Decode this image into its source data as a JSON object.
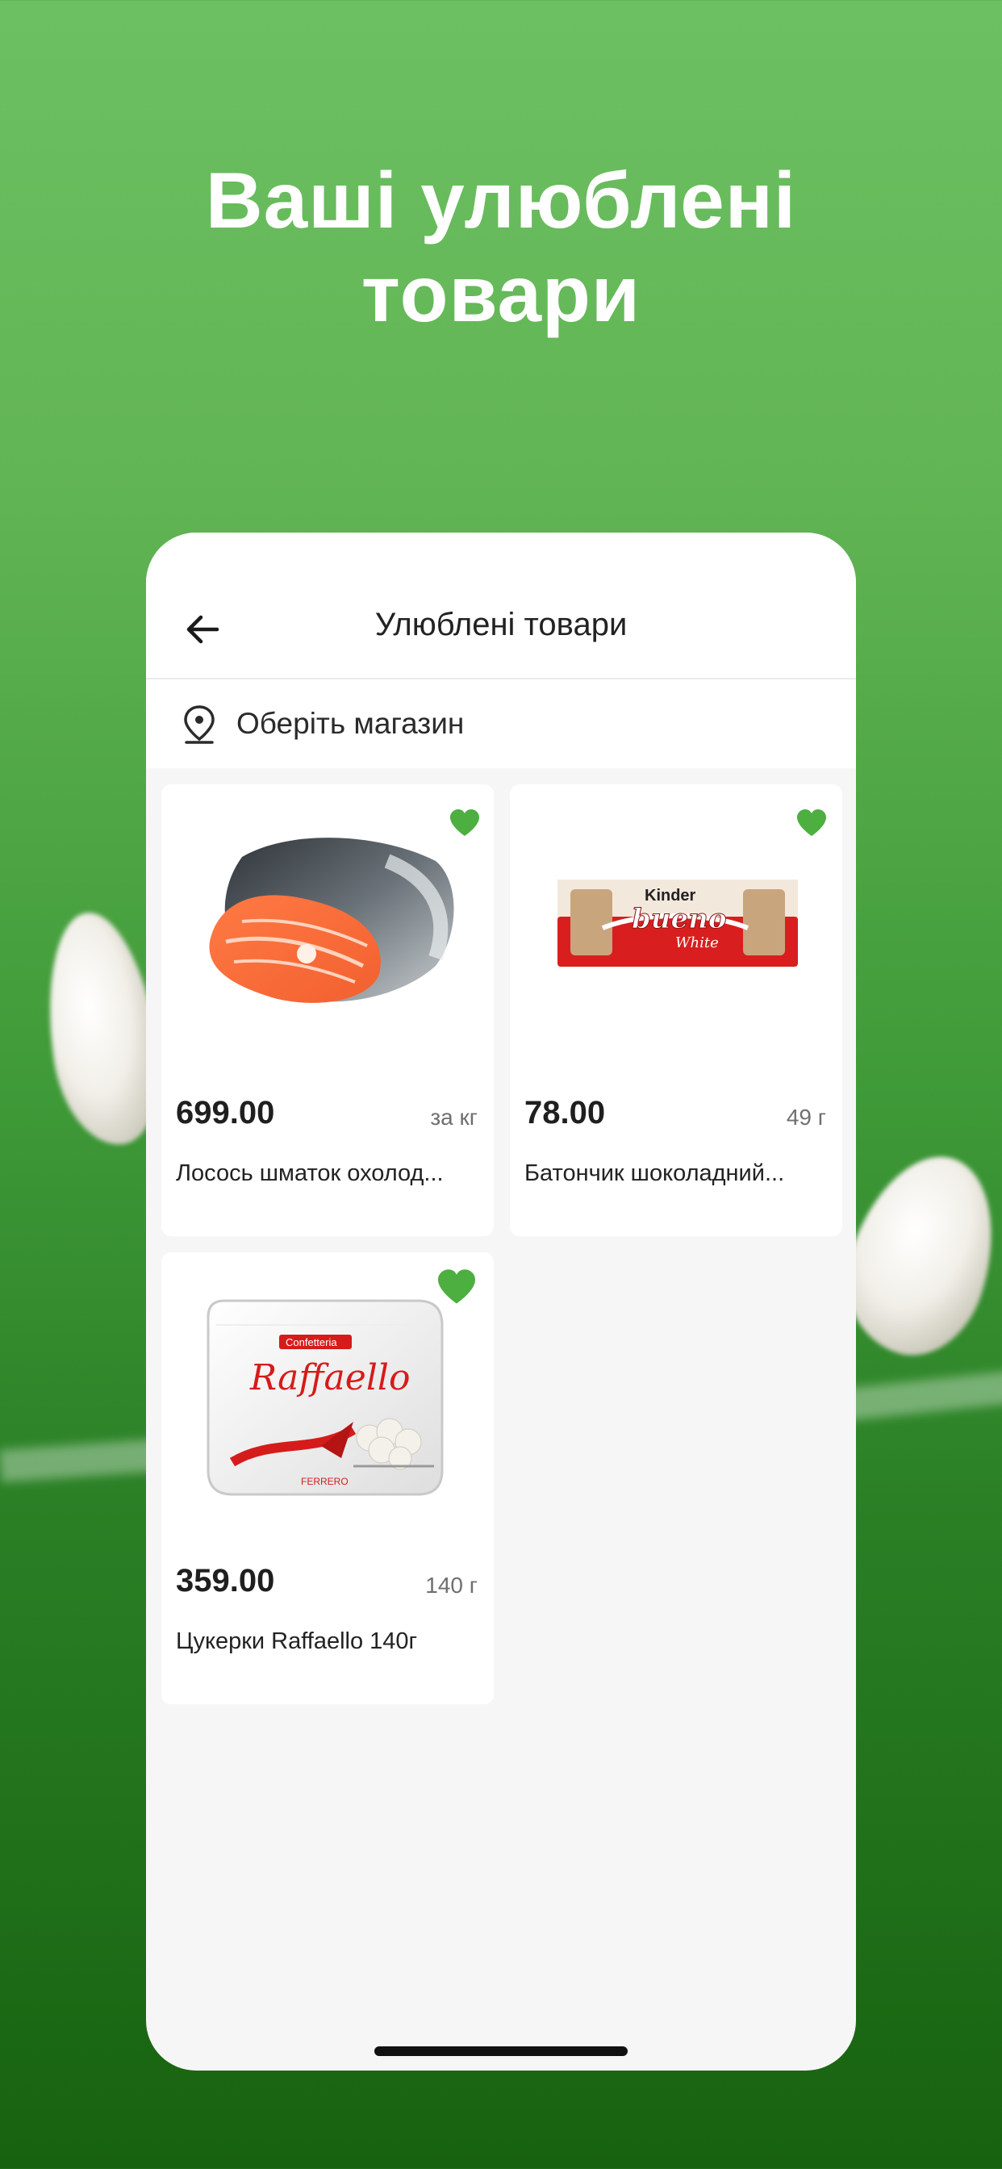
{
  "promo": {
    "title_line1": "Ваші улюблені",
    "title_line2": "товари"
  },
  "header": {
    "title": "Улюблені товари",
    "back_icon": "arrow-left-icon"
  },
  "store": {
    "label": "Оберіть магазин",
    "icon": "location-pin-icon"
  },
  "products": [
    {
      "price": "699.00",
      "unit": "за кг",
      "name": "Лосось шматок охолод...",
      "image_icon": "salmon-steak-image",
      "favorite": true
    },
    {
      "price": "78.00",
      "unit": "49 г",
      "name": "Батончик шоколадний...",
      "image_icon": "kinder-bueno-bar-image",
      "favorite": true
    },
    {
      "price": "359.00",
      "unit": "140 г",
      "name": "Цукерки Raffaello 140г",
      "image_icon": "raffaello-box-image",
      "favorite": true
    }
  ],
  "brand_text": {
    "kinder": "Kinder",
    "bueno": "bueno",
    "white": "White",
    "confetteria": "Confetteria",
    "raffaello": "Raffaello",
    "ferrero": "FERRERO"
  },
  "colors": {
    "accent_green": "#4caf3f",
    "background_top": "#6cc062",
    "background_bottom": "#17620f"
  }
}
